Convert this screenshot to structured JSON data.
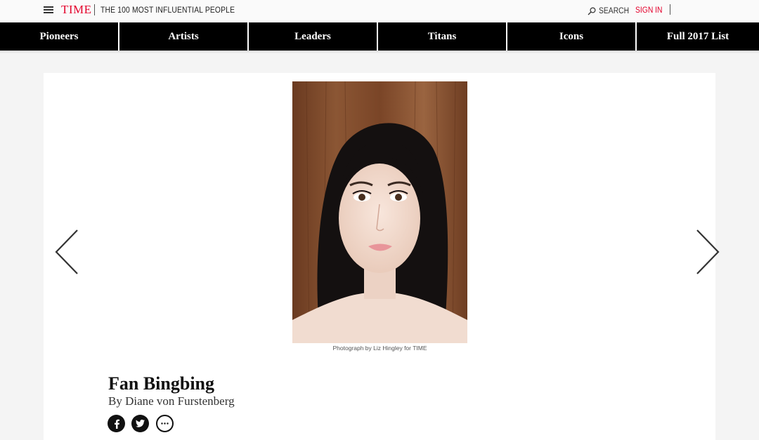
{
  "header": {
    "logo": "TIME",
    "section_title": "THE 100 MOST INFLUENTIAL PEOPLE",
    "search_label": "SEARCH",
    "signin_label": "SIGN IN"
  },
  "nav": {
    "items": [
      {
        "label": "Pioneers"
      },
      {
        "label": "Artists"
      },
      {
        "label": "Leaders"
      },
      {
        "label": "Titans"
      },
      {
        "label": "Icons"
      },
      {
        "label": "Full 2017 List"
      }
    ]
  },
  "article": {
    "photo_caption": "Photograph by Liz Hingley for TIME",
    "name": "Fan Bingbing",
    "byline": "By Diane von Furstenberg"
  },
  "icons": {
    "menu": "hamburger-menu-icon",
    "search": "search-icon",
    "prev": "chevron-left-icon",
    "next": "chevron-right-icon",
    "facebook": "facebook-icon",
    "twitter": "twitter-icon",
    "more": "more-icon"
  },
  "colors": {
    "brand_red": "#e4002b",
    "nav_bg": "#000000",
    "page_bg": "#f4f4f4"
  }
}
